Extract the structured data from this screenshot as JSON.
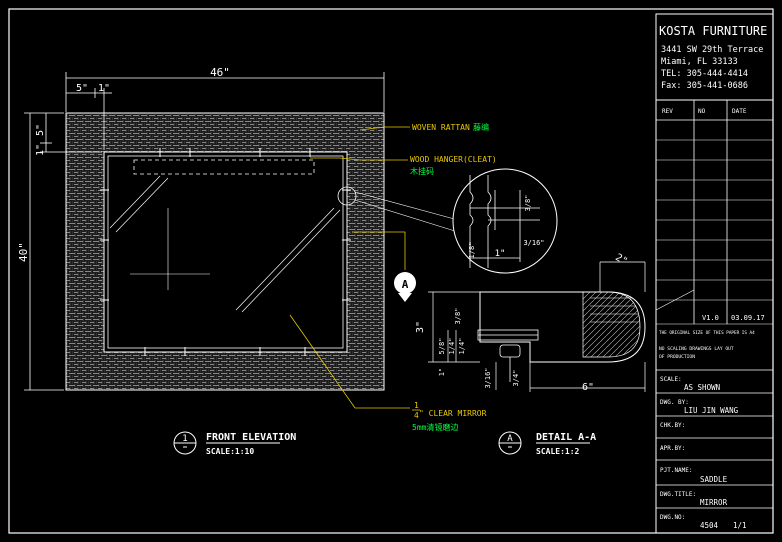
{
  "title_block": {
    "company": "KOSTA FURNITURE",
    "address_1": "3441 SW 29th Terrace",
    "address_2": "Miami, FL   33133",
    "tel": "TEL:   305-444-4414",
    "fax": "Fax:   305-441-0686",
    "rev_header": "REV",
    "no_header": "NO",
    "date_header": "DATE",
    "version": "V1.0",
    "version_date": "03.09.17",
    "note_1": "THE ORIGINAL SIZE OF THIS PAPER IS A4",
    "note_2": "NO SCALING DRAWINGS LAY OUT",
    "note_3": "OF PRODUCTION",
    "scale_label": "SCALE:",
    "scale_value": "AS SHOWN",
    "dwn_label": "DWG. BY:",
    "dwn_value": "LIU JIN WANG",
    "chk_label": "CHK.BY:",
    "apr_label": "APR.BY:",
    "pjt_label": "PJT.NAME:",
    "pjt_value": "SADDLE",
    "dwg_title_label": "DWG.TITLE:",
    "dwg_title_value": "MIRROR",
    "dwg_no_label": "DWG.NO:",
    "dwg_no_value": "4504",
    "sheet_value": "1/1"
  },
  "front_elevation": {
    "title": "FRONT ELEVATION",
    "scale": "SCALE:1:10",
    "callout_number": "1",
    "dim_width": "46\"",
    "dim_frame": "5\"",
    "dim_inset": "1\"",
    "dim_height": "40\"",
    "dim_top_frame": "5\"",
    "dim_top_inset": "1\"",
    "section_tag": "A"
  },
  "annotations": {
    "rattan_en": "WOVEN RATTAN",
    "rattan_cn": "藤编",
    "hanger_en": "WOOD HANGER(CLEAT)",
    "hanger_cn": "木挂码",
    "mirror_fraction_top": "1",
    "mirror_fraction_bottom": "4",
    "mirror_en": "\" CLEAR MIRROR",
    "mirror_cn": "5mm清镜磨边"
  },
  "detail_a": {
    "title": "DETAIL A-A",
    "scale": "SCALE:1:2",
    "callout_letter": "A",
    "dim_2": "2\"",
    "dim_6": "6\"",
    "dim_3": "3\"",
    "dim_3_4": "3/4\"",
    "dim_1_4": "1/4\"",
    "dim_5_8": "5/8\"",
    "dim_1_2": "1/2\"",
    "dim_1": "1\"",
    "dim_3_8": "3/8\"",
    "dim_3_16": "3/16\""
  },
  "detail_circle": {
    "dim_3_8": "3/8\"",
    "dim_3_16": "3/16\"",
    "dim_1": "1\"",
    "dim_1_8": "1/8\""
  },
  "colors": {
    "background": "#000000",
    "line": "#ffffff",
    "annotation": "#e6c800",
    "chinese_text": "#00ff40",
    "leader": "#ff9900"
  }
}
